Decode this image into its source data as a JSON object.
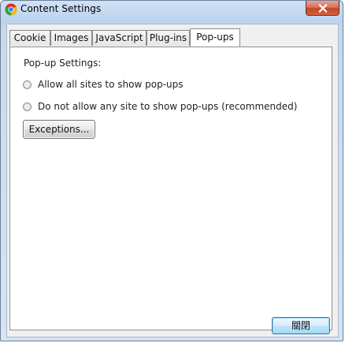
{
  "window": {
    "title": "Content Settings",
    "app_icon": "chrome-icon",
    "close_icon": "close-icon"
  },
  "tabs": [
    {
      "label": "Cookie",
      "active": false
    },
    {
      "label": "Images",
      "active": false
    },
    {
      "label": "JavaScript",
      "active": false
    },
    {
      "label": "Plug-ins",
      "active": false
    },
    {
      "label": "Pop-ups",
      "active": true
    }
  ],
  "popups": {
    "section_label": "Pop-up Settings:",
    "options": [
      {
        "label": "Allow all sites to show pop-ups",
        "selected": false
      },
      {
        "label": "Do not allow any site to show pop-ups (recommended)",
        "selected": false
      }
    ],
    "exceptions_label": "Exceptions..."
  },
  "footer": {
    "close_label": "關閉"
  },
  "colors": {
    "titlebar": "#bcd3ec",
    "close_button": "#c24528",
    "client_bg": "#f0f0f0",
    "default_button_border": "#3c7fb1"
  }
}
